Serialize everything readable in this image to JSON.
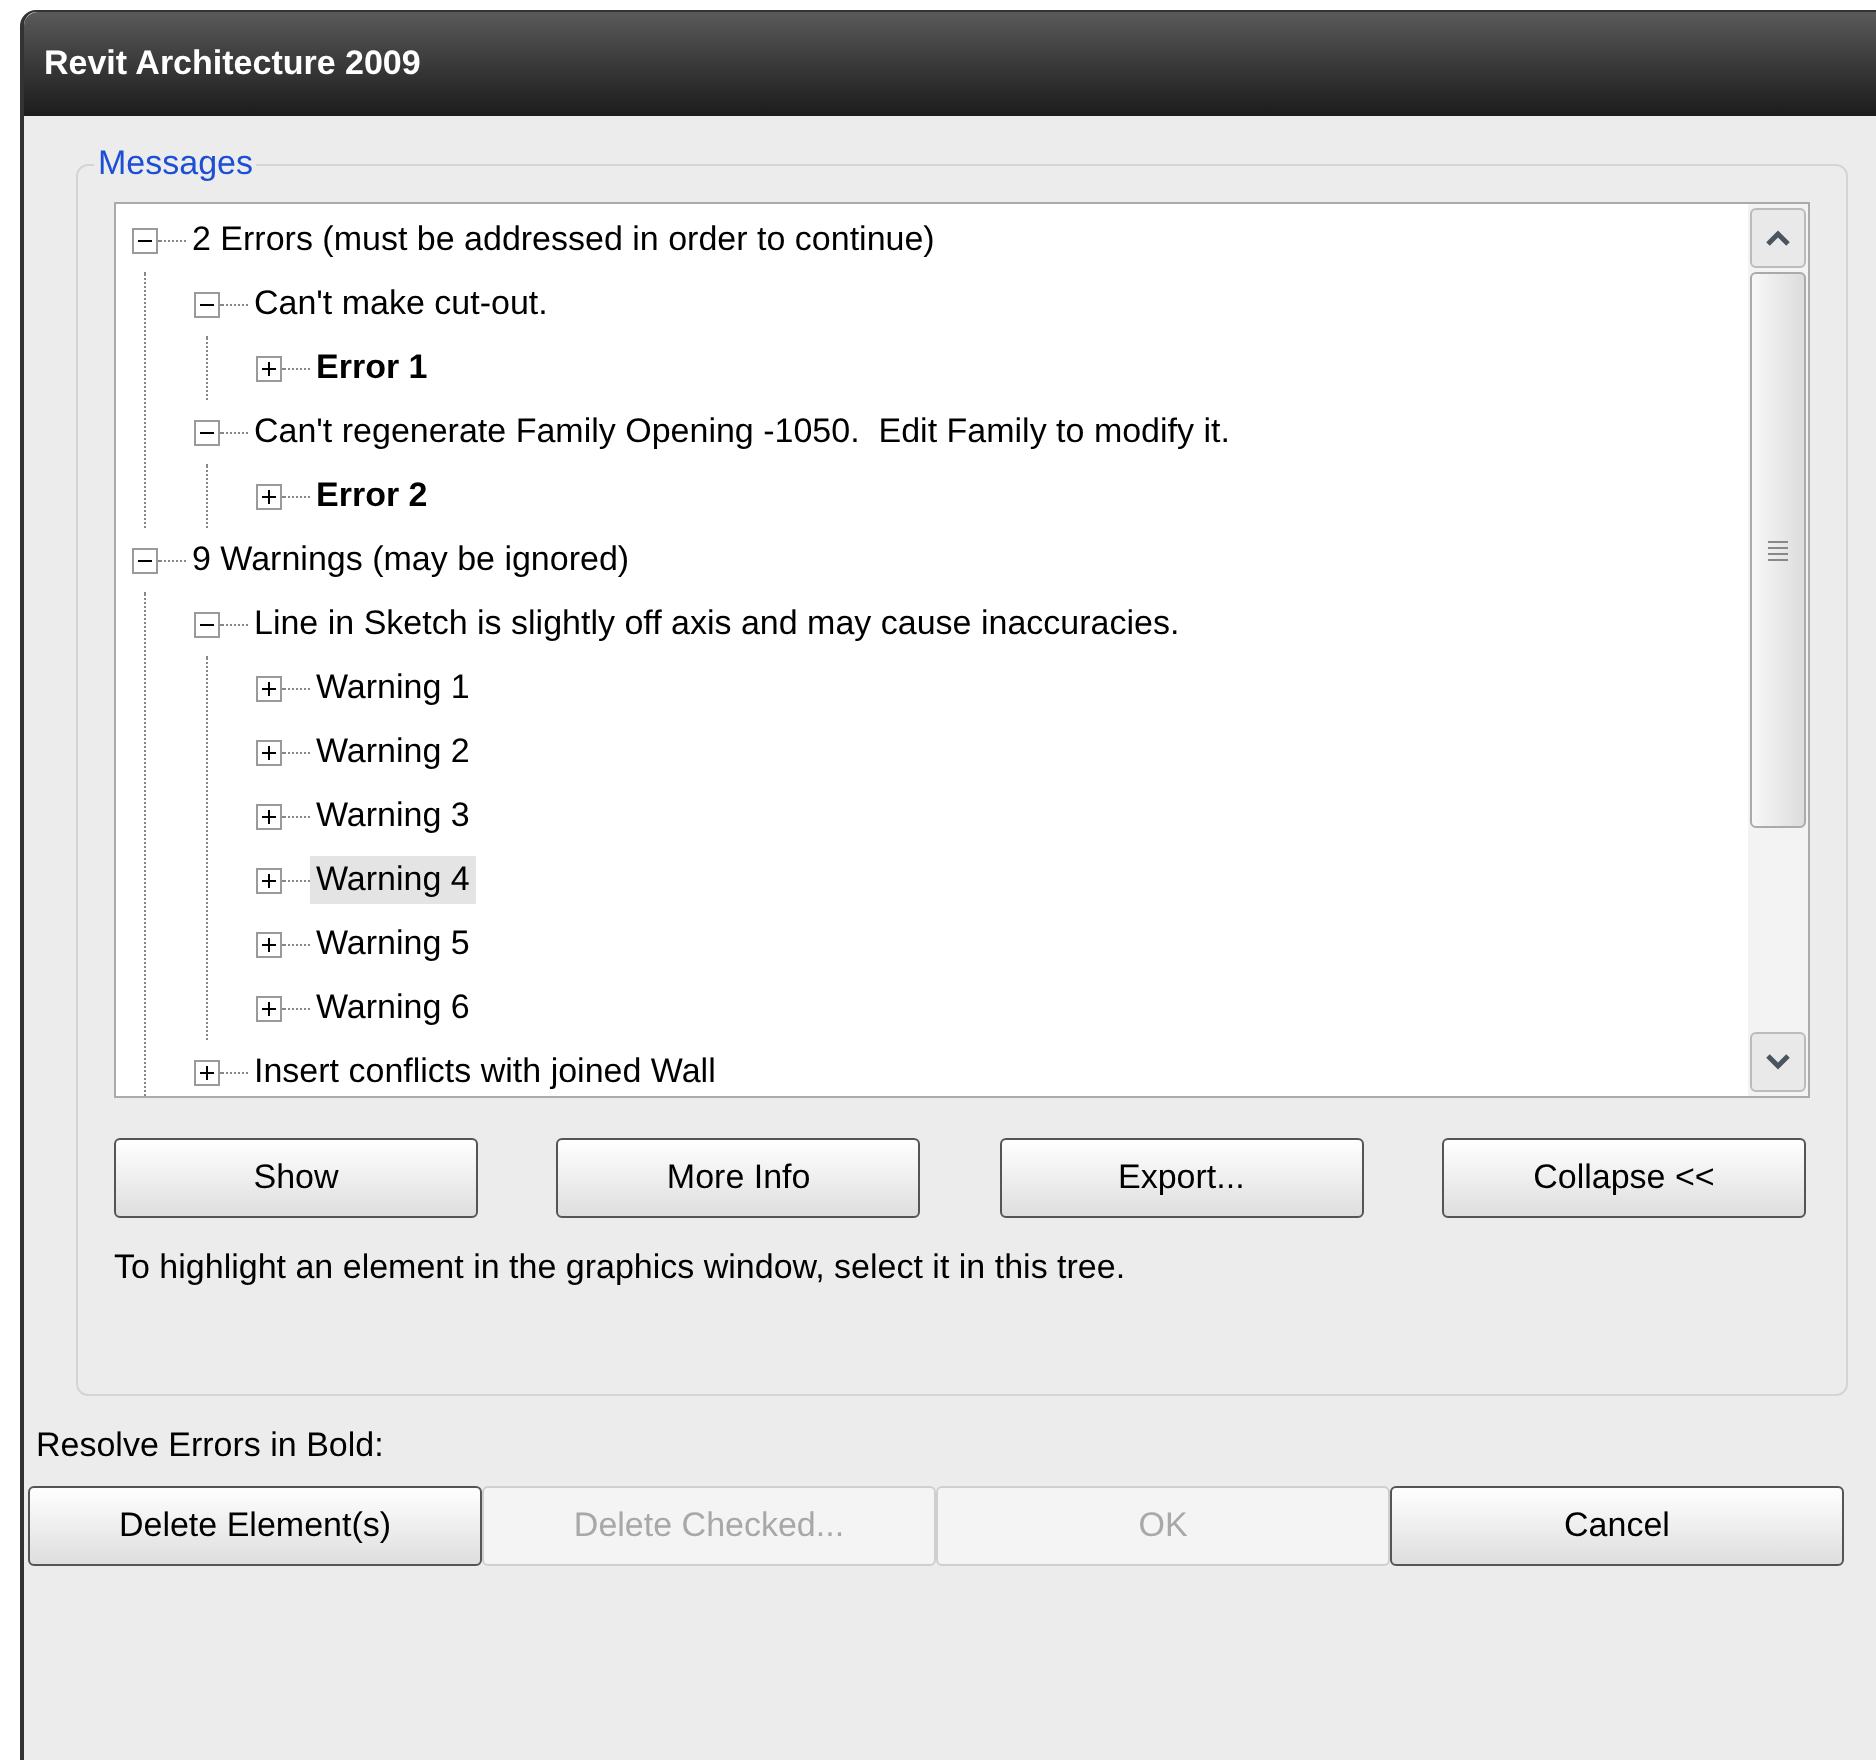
{
  "window": {
    "title": "Revit Architecture 2009"
  },
  "group": {
    "title": "Messages"
  },
  "tree": [
    {
      "label": "2 Errors (must be addressed in order to continue)",
      "expanded": true,
      "bold": false,
      "selected": false,
      "children": [
        {
          "label": "Can't make cut-out.",
          "expanded": true,
          "bold": false,
          "selected": false,
          "children": [
            {
              "label": "Error 1",
              "expanded": false,
              "bold": true,
              "selected": false
            }
          ]
        },
        {
          "label": "Can't regenerate Family Opening -1050.  Edit Family to modify it.",
          "expanded": true,
          "bold": false,
          "selected": false,
          "children": [
            {
              "label": "Error 2",
              "expanded": false,
              "bold": true,
              "selected": false
            }
          ]
        }
      ]
    },
    {
      "label": "9 Warnings (may be ignored)",
      "expanded": true,
      "bold": false,
      "selected": false,
      "children": [
        {
          "label": "Line in Sketch is slightly off axis and may cause inaccuracies.",
          "expanded": true,
          "bold": false,
          "selected": false,
          "children": [
            {
              "label": "Warning 1",
              "expanded": false,
              "bold": false,
              "selected": false
            },
            {
              "label": "Warning 2",
              "expanded": false,
              "bold": false,
              "selected": false
            },
            {
              "label": "Warning 3",
              "expanded": false,
              "bold": false,
              "selected": false
            },
            {
              "label": "Warning 4",
              "expanded": false,
              "bold": false,
              "selected": true
            },
            {
              "label": "Warning 5",
              "expanded": false,
              "bold": false,
              "selected": false
            },
            {
              "label": "Warning 6",
              "expanded": false,
              "bold": false,
              "selected": false
            }
          ]
        },
        {
          "label": "Insert conflicts with joined Wall",
          "expanded": false,
          "bold": false,
          "selected": false
        }
      ]
    }
  ],
  "tree_buttons": [
    {
      "label": "Show",
      "disabled": false
    },
    {
      "label": "More Info",
      "disabled": false
    },
    {
      "label": "Export...",
      "disabled": false
    },
    {
      "label": "Collapse <<",
      "disabled": false
    }
  ],
  "hint": "To highlight an element in the graphics window, select it in this tree.",
  "resolve_label": "Resolve Errors in Bold:",
  "buttons": [
    {
      "label": "Delete Element(s)",
      "disabled": false
    },
    {
      "label": "Delete Checked...",
      "disabled": true
    },
    {
      "label": "OK",
      "disabled": true
    },
    {
      "label": "Cancel",
      "disabled": false
    }
  ]
}
